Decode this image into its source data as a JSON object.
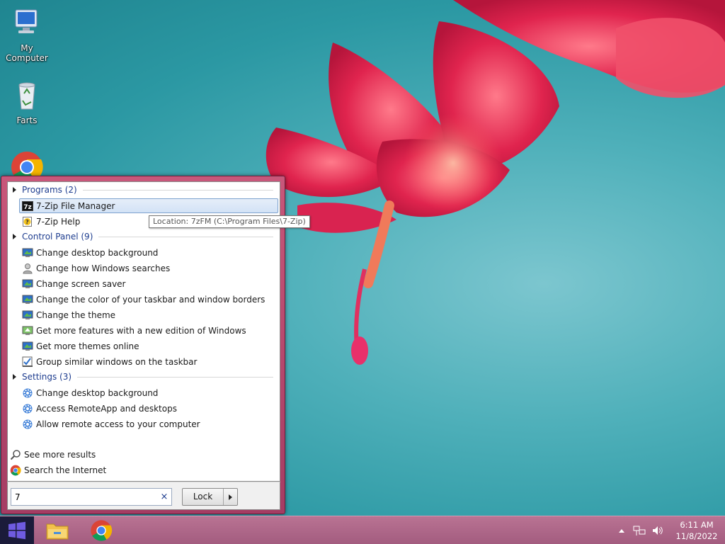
{
  "desktop": {
    "icons": [
      {
        "label": "My Computer",
        "icon": "computer-icon"
      },
      {
        "label": "Farts",
        "icon": "recycle-bin-icon"
      },
      {
        "label": "",
        "icon": "chrome-icon"
      }
    ]
  },
  "start_menu": {
    "groups": [
      {
        "title": "Programs (2)",
        "items": [
          {
            "label": "7-Zip File Manager",
            "icon": "7zip-icon",
            "selected": true
          },
          {
            "label": "7-Zip Help",
            "icon": "help-file-icon"
          }
        ]
      },
      {
        "title": "Control Panel (9)",
        "items": [
          {
            "label": "Change desktop background",
            "icon": "display-icon"
          },
          {
            "label": "Change how Windows searches",
            "icon": "user-search-icon"
          },
          {
            "label": "Change screen saver",
            "icon": "display-icon"
          },
          {
            "label": "Change the color of your taskbar and window borders",
            "icon": "display-icon"
          },
          {
            "label": "Change the theme",
            "icon": "display-icon"
          },
          {
            "label": "Get more features with a new edition of Windows",
            "icon": "upgrade-icon"
          },
          {
            "label": "Get more themes online",
            "icon": "display-icon"
          },
          {
            "label": "Group similar windows on the taskbar",
            "icon": "taskbar-check-icon"
          }
        ]
      },
      {
        "title": "Settings (3)",
        "items": [
          {
            "label": "Change desktop background",
            "icon": "gear-icon"
          },
          {
            "label": "Access RemoteApp and desktops",
            "icon": "gear-icon"
          },
          {
            "label": "Allow remote access to your computer",
            "icon": "gear-icon"
          }
        ]
      }
    ],
    "tooltip": "Location: 7zFM (C:\\Program Files\\7-Zip)",
    "see_more": "See more results",
    "search_internet": "Search the Internet",
    "search": {
      "value": "7",
      "clear_glyph": "×"
    },
    "lock_label": "Lock"
  },
  "taskbar": {
    "time": "6:11 AM",
    "date": "11/8/2022"
  }
}
